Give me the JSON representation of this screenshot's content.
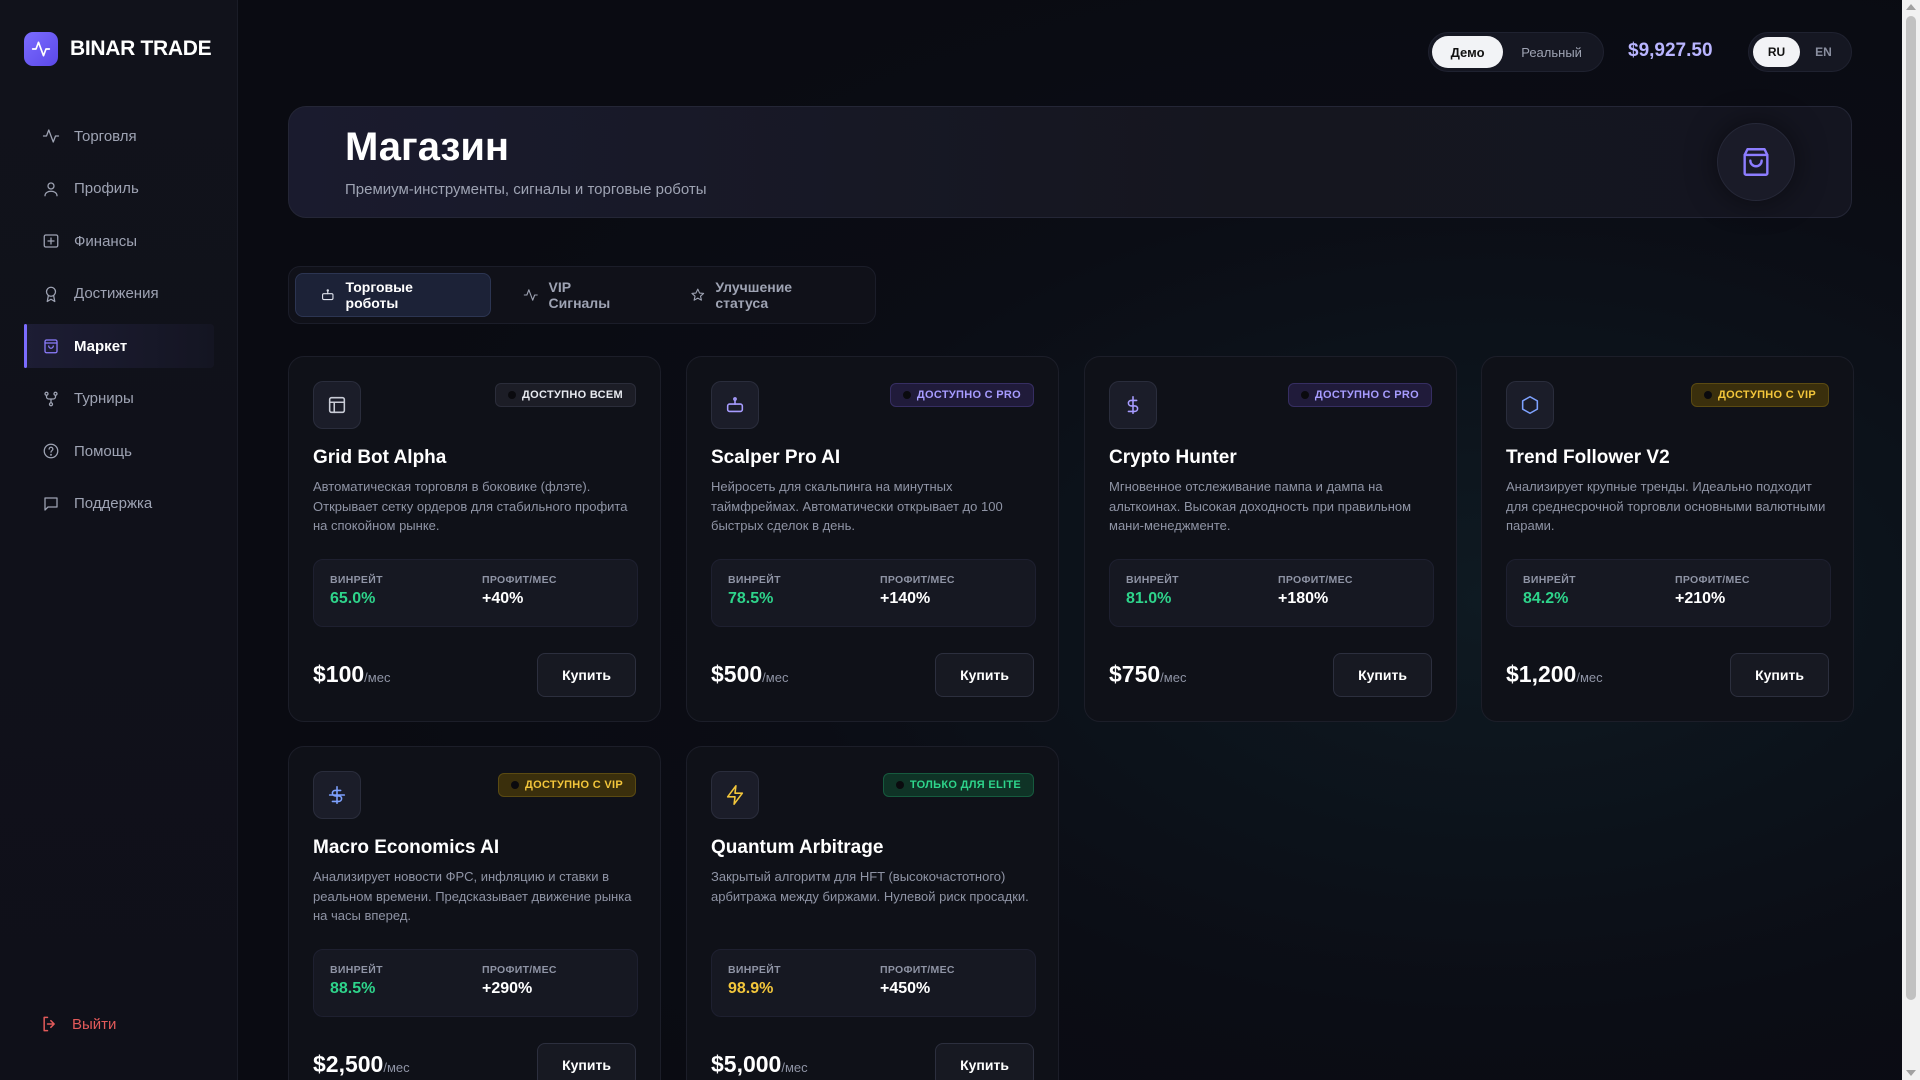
{
  "brand": {
    "name": "BINAR TRADE"
  },
  "sidebar": {
    "items": [
      {
        "label": "Торговля",
        "icon": "activity-icon"
      },
      {
        "label": "Профиль",
        "icon": "user-icon"
      },
      {
        "label": "Финансы",
        "icon": "wallet-icon"
      },
      {
        "label": "Достижения",
        "icon": "award-icon"
      },
      {
        "label": "Маркет",
        "icon": "shopping-bag-icon",
        "active": true
      },
      {
        "label": "Турниры",
        "icon": "git-fork-icon"
      },
      {
        "label": "Помощь",
        "icon": "help-circle-icon"
      },
      {
        "label": "Поддержка",
        "icon": "message-square-icon"
      }
    ],
    "logout": "Выйти"
  },
  "topbar": {
    "mode_demo": "Демо",
    "mode_real": "Реальный",
    "balance": "$9,927.50",
    "lang_ru": "RU",
    "lang_en": "EN"
  },
  "hero": {
    "title": "Магазин",
    "subtitle": "Премиум-инструменты, сигналы и торговые роботы"
  },
  "tabs": [
    {
      "label": "Торговые роботы",
      "icon": "bot-icon",
      "active": true
    },
    {
      "label": "VIP Сигналы",
      "icon": "activity-icon"
    },
    {
      "label": "Улучшение статуса",
      "icon": "star-icon"
    }
  ],
  "stats_labels": {
    "winrate": "ВИНРЕЙТ",
    "profit": "ПРОФИТ/МЕС"
  },
  "per_month": "/мес",
  "buy_label": "Купить",
  "products": [
    {
      "title": "Grid Bot Alpha",
      "badge": "ДОСТУПНО ВСЕМ",
      "tier": "all",
      "icon": "layout-grid-icon",
      "desc": "Автоматическая торговля в боковике (флэте). Открывает сетку ордеров для стабильного профита на спокойном рынке.",
      "winrate": "65.0%",
      "profit": "+40%",
      "price": "$100"
    },
    {
      "title": "Scalper Pro AI",
      "badge": "ДОСТУПНО С PRO",
      "tier": "pro",
      "icon": "bot-icon",
      "desc": "Нейросеть для скальпинга на минутных таймфреймах. Автоматически открывает до 100 быстрых сделок в день.",
      "winrate": "78.5%",
      "profit": "+140%",
      "price": "$500"
    },
    {
      "title": "Crypto Hunter",
      "badge": "ДОСТУПНО С PRO",
      "tier": "pro",
      "icon": "dollar-icon",
      "desc": "Мгновенное отслеживание пампа и дампа на альткоинах. Высокая доходность при правильном мани-менеджменте.",
      "winrate": "81.0%",
      "profit": "+180%",
      "price": "$750"
    },
    {
      "title": "Trend Follower V2",
      "badge": "ДОСТУПНО С VIP",
      "tier": "vip",
      "icon": "hexagon-icon",
      "desc": "Анализирует крупные тренды. Идеально подходит для среднесрочной торговли основными валютными парами.",
      "winrate": "84.2%",
      "profit": "+210%",
      "price": "$1,200"
    },
    {
      "title": "Macro Economics AI",
      "badge": "ДОСТУПНО С VIP",
      "tier": "vip",
      "icon": "dollar-strike-icon",
      "desc": "Анализирует новости ФРС, инфляцию и ставки в реальном времени. Предсказывает движение рынка на часы вперед.",
      "winrate": "88.5%",
      "profit": "+290%",
      "price": "$2,500"
    },
    {
      "title": "Quantum Arbitrage",
      "badge": "ТОЛЬКО ДЛЯ ELITE",
      "tier": "elite",
      "icon": "zap-icon",
      "desc": "Закрытый алгоритм для HFT (высокочастотного) арбитража между биржами. Нулевой риск просадки.",
      "winrate": "98.9%",
      "profit": "+450%",
      "price": "$5,000",
      "gold": true
    }
  ],
  "colors": {
    "accent": "#7b6cff",
    "green": "#2ed48b",
    "gold": "#f3c63b",
    "danger": "#e25a5a"
  }
}
